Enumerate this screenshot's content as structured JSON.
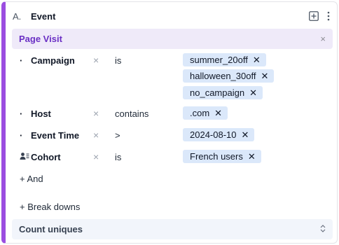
{
  "event": {
    "letter": "A.",
    "title": "Event",
    "add_icon": "plus-square-icon",
    "menu_icon": "more-vertical-icon"
  },
  "event_name": {
    "label": "Page Visit",
    "close_icon": "close-icon",
    "close_glyph": "×"
  },
  "filters": [
    {
      "bullet": "·",
      "property": "Campaign",
      "remove": "×",
      "operator": "is",
      "values": [
        {
          "text": "summer_20off",
          "x": "✕"
        },
        {
          "text": "halloween_30off",
          "x": "✕"
        },
        {
          "text": "no_campaign",
          "x": "✕"
        }
      ]
    },
    {
      "bullet": "·",
      "property": "Host",
      "remove": "×",
      "operator": "contains",
      "values": [
        {
          "text": ".com",
          "x": "✕"
        }
      ]
    },
    {
      "bullet": "·",
      "property": "Event Time",
      "remove": "×",
      "operator": ">",
      "values": [
        {
          "text": "2024-08-10",
          "x": "✕"
        }
      ]
    },
    {
      "icon": "cohort-icon",
      "property": "Cohort",
      "remove": "×",
      "operator": "is",
      "values": [
        {
          "text": "French users",
          "x": "✕"
        }
      ]
    }
  ],
  "and_label": "+ And",
  "breakdowns_label": "+ Break downs",
  "count": {
    "label": "Count uniques",
    "caret_icon": "chevron-up-down-icon"
  },
  "colors": {
    "accent": "#9b4de0",
    "event_label": "#6a2fc4",
    "chip_bg": "#dbe8fa",
    "event_bar_bg": "#efeaf9"
  }
}
